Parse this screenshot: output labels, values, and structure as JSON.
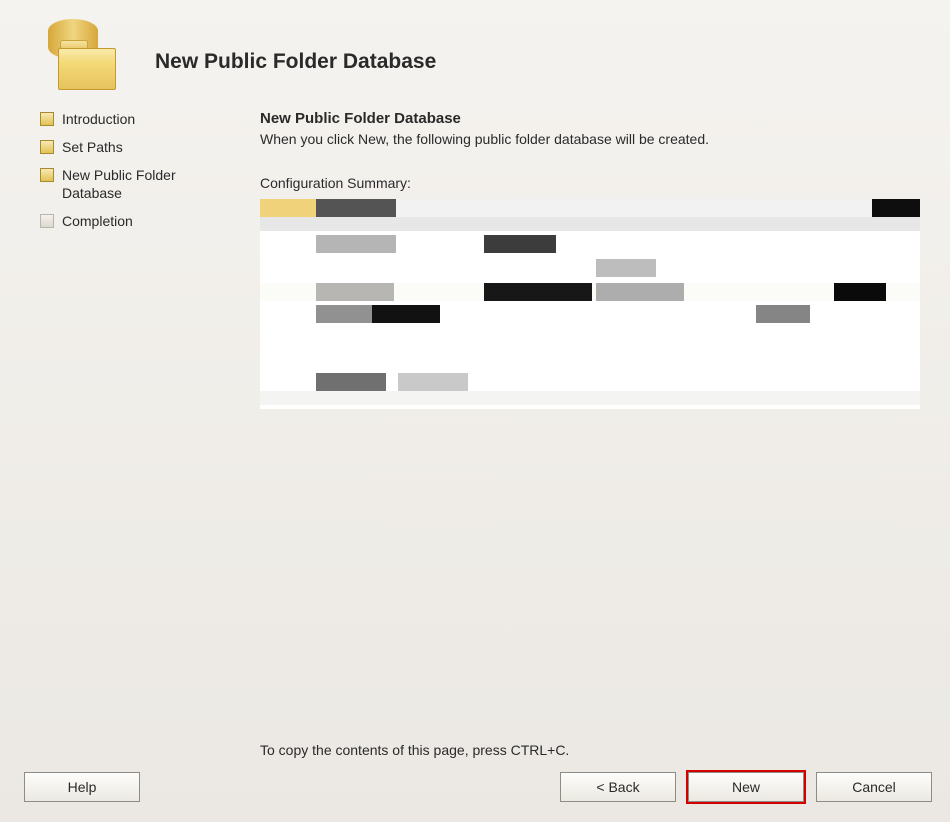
{
  "header": {
    "title": "New Public Folder Database"
  },
  "sidebar": {
    "steps": [
      {
        "label": "Introduction",
        "status": "done"
      },
      {
        "label": "Set Paths",
        "status": "done"
      },
      {
        "label": "New Public Folder Database",
        "status": "current"
      },
      {
        "label": "Completion",
        "status": "pending"
      }
    ]
  },
  "content": {
    "title": "New Public Folder Database",
    "subtitle": "When you click New, the following public folder database will be created.",
    "config_label": "Configuration Summary:"
  },
  "footer": {
    "copy_hint": "To copy the contents of this page, press CTRL+C.",
    "help_label": "Help",
    "back_label": "< Back",
    "new_label": "New",
    "cancel_label": "Cancel"
  }
}
